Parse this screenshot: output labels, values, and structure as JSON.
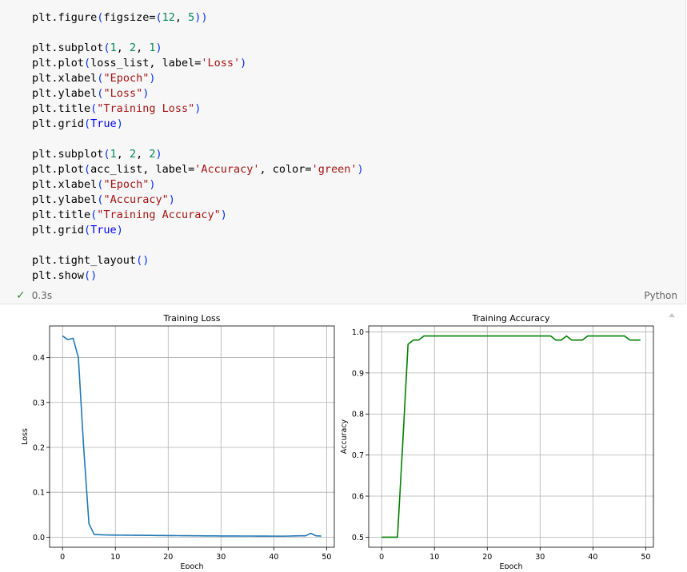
{
  "code_cell": {
    "lines": [
      [
        {
          "t": "plt.",
          "c": "plain"
        },
        {
          "t": "figure",
          "c": "plain"
        },
        {
          "t": "(",
          "c": "paren"
        },
        {
          "t": "figsize",
          "c": "plain"
        },
        {
          "t": "=",
          "c": "op"
        },
        {
          "t": "(",
          "c": "paren"
        },
        {
          "t": "12",
          "c": "num"
        },
        {
          "t": ", ",
          "c": "plain"
        },
        {
          "t": "5",
          "c": "num"
        },
        {
          "t": ")",
          "c": "paren"
        },
        {
          "t": ")",
          "c": "paren"
        }
      ],
      [],
      [
        {
          "t": "plt.",
          "c": "plain"
        },
        {
          "t": "subplot",
          "c": "plain"
        },
        {
          "t": "(",
          "c": "paren"
        },
        {
          "t": "1",
          "c": "num"
        },
        {
          "t": ", ",
          "c": "plain"
        },
        {
          "t": "2",
          "c": "num"
        },
        {
          "t": ", ",
          "c": "plain"
        },
        {
          "t": "1",
          "c": "num"
        },
        {
          "t": ")",
          "c": "paren"
        }
      ],
      [
        {
          "t": "plt.",
          "c": "plain"
        },
        {
          "t": "plot",
          "c": "plain"
        },
        {
          "t": "(",
          "c": "paren"
        },
        {
          "t": "loss_list, label",
          "c": "plain"
        },
        {
          "t": "=",
          "c": "op"
        },
        {
          "t": "'Loss'",
          "c": "str"
        },
        {
          "t": ")",
          "c": "paren"
        }
      ],
      [
        {
          "t": "plt.",
          "c": "plain"
        },
        {
          "t": "xlabel",
          "c": "plain"
        },
        {
          "t": "(",
          "c": "paren"
        },
        {
          "t": "\"Epoch\"",
          "c": "str"
        },
        {
          "t": ")",
          "c": "paren"
        }
      ],
      [
        {
          "t": "plt.",
          "c": "plain"
        },
        {
          "t": "ylabel",
          "c": "plain"
        },
        {
          "t": "(",
          "c": "paren"
        },
        {
          "t": "\"Loss\"",
          "c": "str"
        },
        {
          "t": ")",
          "c": "paren"
        }
      ],
      [
        {
          "t": "plt.",
          "c": "plain"
        },
        {
          "t": "title",
          "c": "plain"
        },
        {
          "t": "(",
          "c": "paren"
        },
        {
          "t": "\"Training Loss\"",
          "c": "str"
        },
        {
          "t": ")",
          "c": "paren"
        }
      ],
      [
        {
          "t": "plt.",
          "c": "plain"
        },
        {
          "t": "grid",
          "c": "plain"
        },
        {
          "t": "(",
          "c": "paren"
        },
        {
          "t": "True",
          "c": "kw"
        },
        {
          "t": ")",
          "c": "paren"
        }
      ],
      [],
      [
        {
          "t": "plt.",
          "c": "plain"
        },
        {
          "t": "subplot",
          "c": "plain"
        },
        {
          "t": "(",
          "c": "paren"
        },
        {
          "t": "1",
          "c": "num"
        },
        {
          "t": ", ",
          "c": "plain"
        },
        {
          "t": "2",
          "c": "num"
        },
        {
          "t": ", ",
          "c": "plain"
        },
        {
          "t": "2",
          "c": "num"
        },
        {
          "t": ")",
          "c": "paren"
        }
      ],
      [
        {
          "t": "plt.",
          "c": "plain"
        },
        {
          "t": "plot",
          "c": "plain"
        },
        {
          "t": "(",
          "c": "paren"
        },
        {
          "t": "acc_list, label",
          "c": "plain"
        },
        {
          "t": "=",
          "c": "op"
        },
        {
          "t": "'Accuracy'",
          "c": "str"
        },
        {
          "t": ", color",
          "c": "plain"
        },
        {
          "t": "=",
          "c": "op"
        },
        {
          "t": "'green'",
          "c": "str"
        },
        {
          "t": ")",
          "c": "paren"
        }
      ],
      [
        {
          "t": "plt.",
          "c": "plain"
        },
        {
          "t": "xlabel",
          "c": "plain"
        },
        {
          "t": "(",
          "c": "paren"
        },
        {
          "t": "\"Epoch\"",
          "c": "str"
        },
        {
          "t": ")",
          "c": "paren"
        }
      ],
      [
        {
          "t": "plt.",
          "c": "plain"
        },
        {
          "t": "ylabel",
          "c": "plain"
        },
        {
          "t": "(",
          "c": "paren"
        },
        {
          "t": "\"Accuracy\"",
          "c": "str"
        },
        {
          "t": ")",
          "c": "paren"
        }
      ],
      [
        {
          "t": "plt.",
          "c": "plain"
        },
        {
          "t": "title",
          "c": "plain"
        },
        {
          "t": "(",
          "c": "paren"
        },
        {
          "t": "\"Training Accuracy\"",
          "c": "str"
        },
        {
          "t": ")",
          "c": "paren"
        }
      ],
      [
        {
          "t": "plt.",
          "c": "plain"
        },
        {
          "t": "grid",
          "c": "plain"
        },
        {
          "t": "(",
          "c": "paren"
        },
        {
          "t": "True",
          "c": "kw"
        },
        {
          "t": ")",
          "c": "paren"
        }
      ],
      [],
      [
        {
          "t": "plt.",
          "c": "plain"
        },
        {
          "t": "tight_layout",
          "c": "plain"
        },
        {
          "t": "(",
          "c": "paren"
        },
        {
          "t": ")",
          "c": "paren"
        }
      ],
      [
        {
          "t": "plt.",
          "c": "plain"
        },
        {
          "t": "show",
          "c": "plain"
        },
        {
          "t": "(",
          "c": "paren"
        },
        {
          "t": ")",
          "c": "paren"
        }
      ]
    ],
    "status_time": "0.3s",
    "language": "Python"
  },
  "chart_data": [
    {
      "type": "line",
      "title": "Training Loss",
      "xlabel": "Epoch",
      "ylabel": "Loss",
      "xlim": [
        -2.45,
        51.45
      ],
      "ylim": [
        -0.0224,
        0.4704
      ],
      "xticks": [
        0,
        10,
        20,
        30,
        40,
        50
      ],
      "yticks": [
        0.0,
        0.1,
        0.2,
        0.3,
        0.4
      ],
      "ytick_labels": [
        "0.0",
        "0.1",
        "0.2",
        "0.3",
        "0.4"
      ],
      "grid": true,
      "color": "#1f77b4",
      "x": [
        0,
        1,
        2,
        3,
        4,
        5,
        6,
        7,
        8,
        9,
        10,
        11,
        12,
        13,
        14,
        15,
        16,
        17,
        18,
        19,
        20,
        21,
        22,
        23,
        24,
        25,
        26,
        27,
        28,
        29,
        30,
        31,
        32,
        33,
        34,
        35,
        36,
        37,
        38,
        39,
        40,
        41,
        42,
        43,
        44,
        45,
        46,
        47,
        48,
        49
      ],
      "values": [
        0.448,
        0.44,
        0.443,
        0.4,
        0.2,
        0.03,
        0.006,
        0.0055,
        0.005,
        0.0048,
        0.0046,
        0.0045,
        0.0044,
        0.0043,
        0.0042,
        0.0041,
        0.004,
        0.0039,
        0.0038,
        0.0037,
        0.0036,
        0.0035,
        0.0034,
        0.0033,
        0.0032,
        0.0031,
        0.003,
        0.0029,
        0.0028,
        0.0028,
        0.0027,
        0.0027,
        0.0026,
        0.0026,
        0.0025,
        0.0025,
        0.0025,
        0.0024,
        0.0024,
        0.0024,
        0.0023,
        0.0023,
        0.0023,
        0.0025,
        0.0028,
        0.003,
        0.0031,
        0.0085,
        0.003,
        0.0025
      ]
    },
    {
      "type": "line",
      "title": "Training Accuracy",
      "xlabel": "Epoch",
      "ylabel": "Accuracy",
      "xlim": [
        -2.45,
        51.45
      ],
      "ylim": [
        0.4755,
        1.0145
      ],
      "xticks": [
        0,
        10,
        20,
        30,
        40,
        50
      ],
      "yticks": [
        0.5,
        0.6,
        0.7,
        0.8,
        0.9,
        1.0
      ],
      "ytick_labels": [
        "0.5",
        "0.6",
        "0.7",
        "0.8",
        "0.9",
        "1.0"
      ],
      "grid": true,
      "color": "#008000",
      "x": [
        0,
        1,
        2,
        3,
        4,
        5,
        6,
        7,
        8,
        9,
        10,
        11,
        12,
        13,
        14,
        15,
        16,
        17,
        18,
        19,
        20,
        21,
        22,
        23,
        24,
        25,
        26,
        27,
        28,
        29,
        30,
        31,
        32,
        33,
        34,
        35,
        36,
        37,
        38,
        39,
        40,
        41,
        42,
        43,
        44,
        45,
        46,
        47,
        48,
        49
      ],
      "values": [
        0.5,
        0.5,
        0.5,
        0.5,
        0.73,
        0.97,
        0.98,
        0.98,
        0.99,
        0.99,
        0.99,
        0.99,
        0.99,
        0.99,
        0.99,
        0.99,
        0.99,
        0.99,
        0.99,
        0.99,
        0.99,
        0.99,
        0.99,
        0.99,
        0.99,
        0.99,
        0.99,
        0.99,
        0.99,
        0.99,
        0.99,
        0.99,
        0.99,
        0.98,
        0.98,
        0.99,
        0.98,
        0.98,
        0.98,
        0.99,
        0.99,
        0.99,
        0.99,
        0.99,
        0.99,
        0.99,
        0.99,
        0.98,
        0.98,
        0.98
      ]
    }
  ]
}
